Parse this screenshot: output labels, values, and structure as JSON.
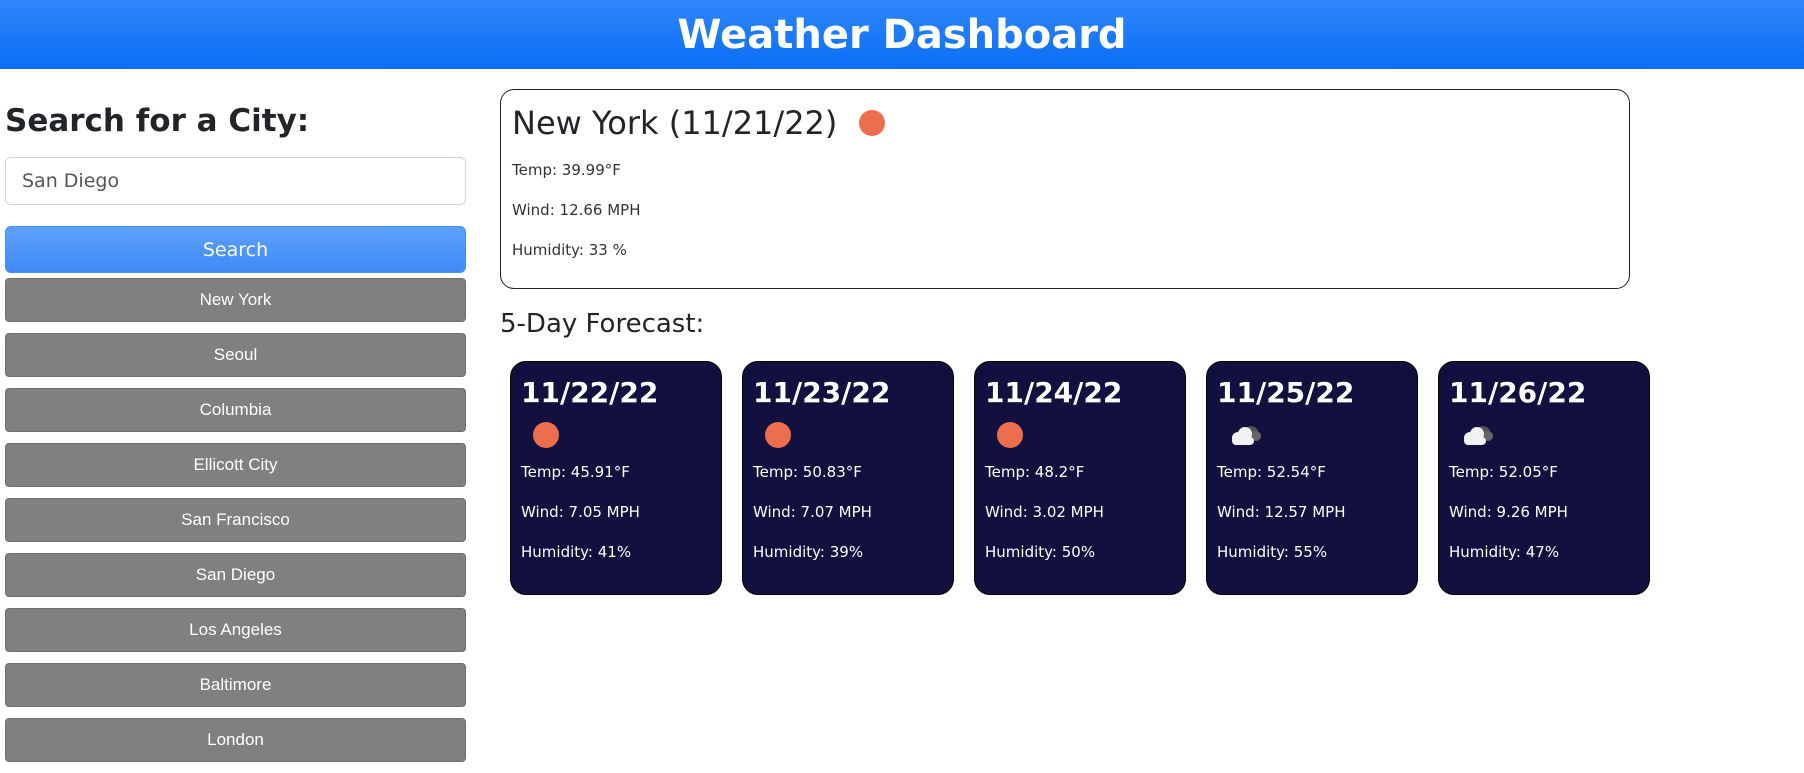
{
  "header": {
    "title": "Weather Dashboard"
  },
  "search": {
    "title": "Search for a City:",
    "input_value": "San Diego",
    "button_label": "Search"
  },
  "history": [
    "New York",
    "Seoul",
    "Columbia",
    "Ellicott City",
    "San Francisco",
    "San Diego",
    "Los Angeles",
    "Baltimore",
    "London"
  ],
  "current": {
    "title": "New York (11/21/22)",
    "icon": "sun-icon",
    "temp": "Temp: 39.99°F",
    "wind": "Wind: 12.66 MPH",
    "humidity": "Humidity: 33 %"
  },
  "forecast": {
    "title": "5-Day Forecast:",
    "days": [
      {
        "date": "11/22/22",
        "icon": "sun-icon",
        "temp": "Temp: 45.91°F",
        "wind": "Wind: 7.05 MPH",
        "humidity": "Humidity: 41%"
      },
      {
        "date": "11/23/22",
        "icon": "sun-icon",
        "temp": "Temp: 50.83°F",
        "wind": "Wind: 7.07 MPH",
        "humidity": "Humidity: 39%"
      },
      {
        "date": "11/24/22",
        "icon": "sun-icon",
        "temp": "Temp: 48.2°F",
        "wind": "Wind: 3.02 MPH",
        "humidity": "Humidity: 50%"
      },
      {
        "date": "11/25/22",
        "icon": "cloud-icon",
        "temp": "Temp: 52.54°F",
        "wind": "Wind: 12.57 MPH",
        "humidity": "Humidity: 55%"
      },
      {
        "date": "11/26/22",
        "icon": "cloud-icon",
        "temp": "Temp: 52.05°F",
        "wind": "Wind: 9.26 MPH",
        "humidity": "Humidity: 47%"
      }
    ]
  },
  "colors": {
    "header_blue": "#1a78f7",
    "search_button": "#4a90f6",
    "history_button": "#808080",
    "card_background": "#11103f",
    "sun": "#ec6e4c"
  }
}
